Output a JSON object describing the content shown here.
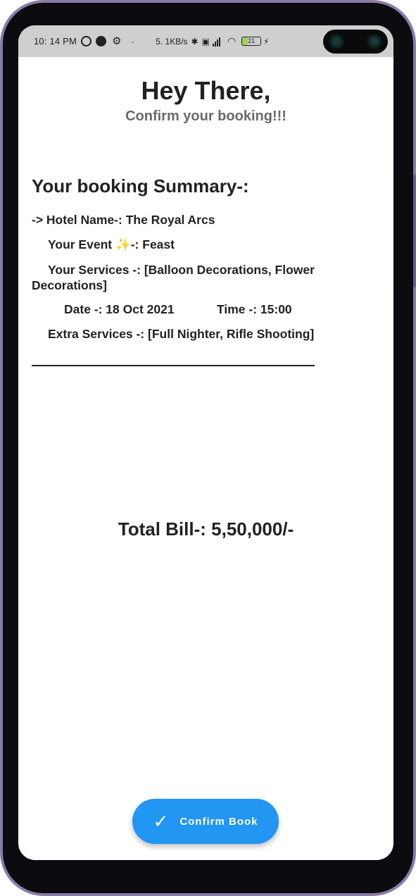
{
  "status_bar": {
    "time": "10: 14 PM",
    "net_speed": "5. 1KB/s",
    "battery_level": "21",
    "icons": [
      "whatsapp-icon",
      "data-saver-icon",
      "gear-icon",
      "bluetooth-icon",
      "volte-icon",
      "signal-icon",
      "wifi-icon",
      "battery-icon",
      "charging-icon"
    ]
  },
  "header": {
    "title": "Hey There,",
    "subtitle": "Confirm your booking!!!"
  },
  "summary": {
    "heading": "Your booking Summary-:",
    "hotel": "-> Hotel Name-: The Royal Arcs",
    "event": "Your Event ✨-: Feast",
    "services": "Your Services -: [Balloon Decorations, Flower Decorations]",
    "date": "Date -: 18 Oct 2021",
    "time": "Time -: 15:00",
    "extra": "Extra Services -: [Full Nighter, Rifle Shooting]"
  },
  "total": {
    "label": "Total Bill-: 5,50,000/-"
  },
  "fab": {
    "label": "Confirm Book",
    "icon": "check-icon",
    "color": "#2196f3"
  }
}
